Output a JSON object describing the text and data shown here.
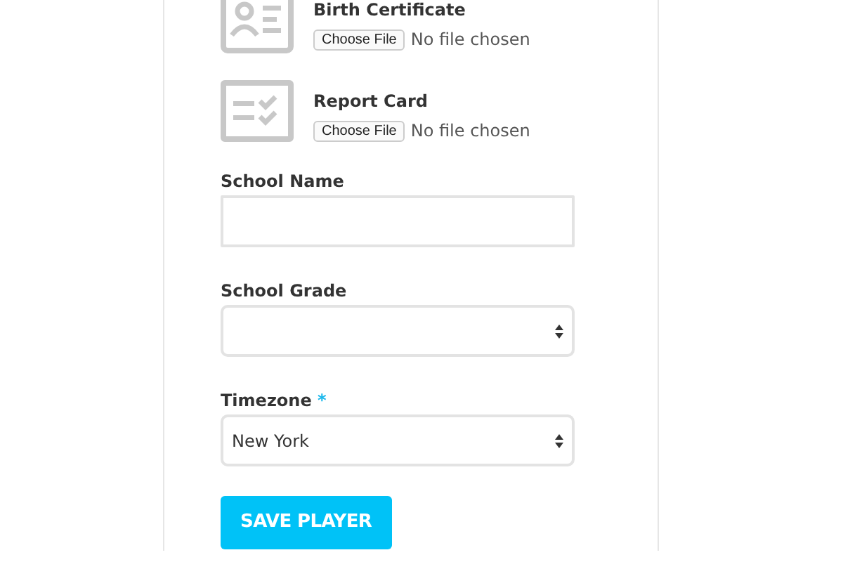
{
  "uploads": [
    {
      "kind": "id-card",
      "label": "Birth Certificate",
      "button": "Choose File",
      "status": "No file chosen"
    },
    {
      "kind": "checklist",
      "label": "Report Card",
      "button": "Choose File",
      "status": "No file chosen"
    }
  ],
  "fields": [
    {
      "kind": "text",
      "label": "School Name",
      "required": false
    },
    {
      "kind": "select",
      "label": "School Grade",
      "required": false
    },
    {
      "kind": "select",
      "label": "Timezone",
      "required": true,
      "required_mark": "*",
      "value": "New York"
    }
  ],
  "submit": "SAVE PLAYER"
}
